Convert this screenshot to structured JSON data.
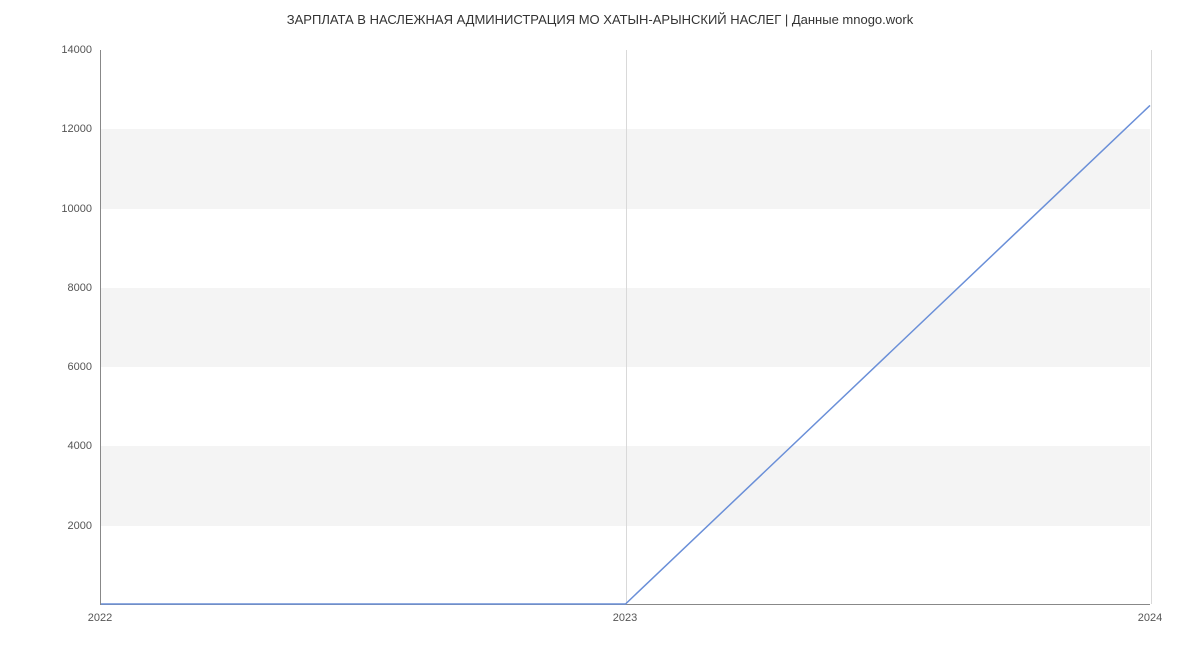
{
  "chart_data": {
    "type": "line",
    "title": "ЗАРПЛАТА В НАСЛЕЖНАЯ АДМИНИСТРАЦИЯ МО ХАТЫН-АРЫНСКИЙ НАСЛЕГ | Данные mnogo.work",
    "x": [
      2022,
      2023,
      2024
    ],
    "y": [
      0,
      0,
      12600
    ],
    "xlabel": "",
    "ylabel": "",
    "xticks": [
      2022,
      2023,
      2024
    ],
    "yticks": [
      2000,
      4000,
      6000,
      8000,
      10000,
      12000,
      14000
    ],
    "ylim": [
      0,
      14000
    ],
    "xlim": [
      2022,
      2024
    ],
    "line_color": "#6a8fd8"
  }
}
